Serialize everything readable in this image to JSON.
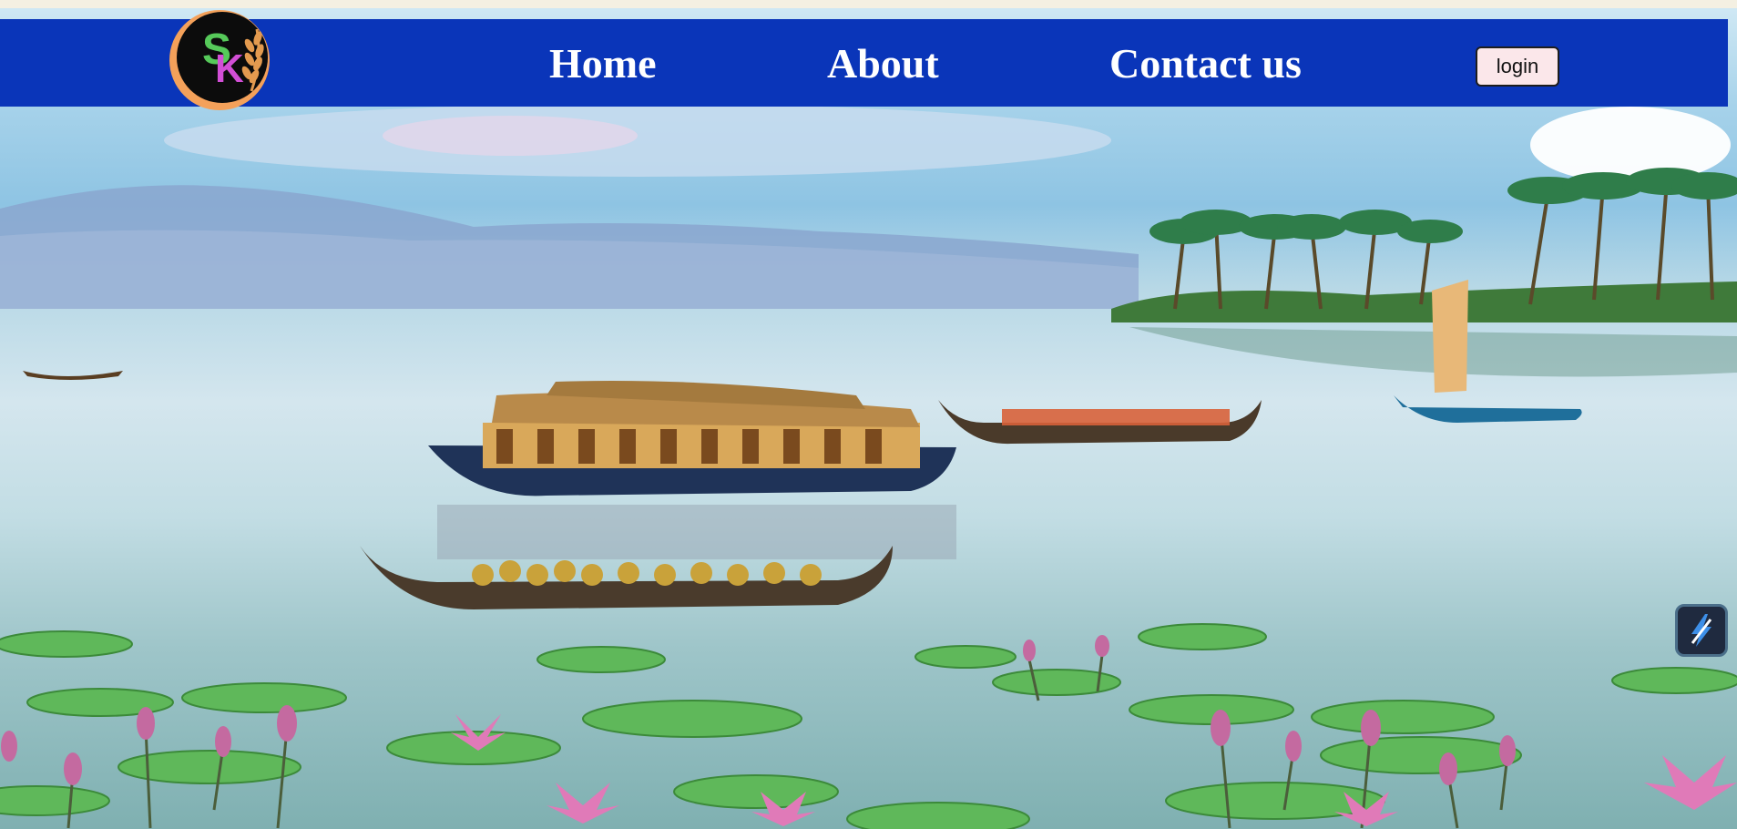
{
  "navbar": {
    "logo_text": "SK",
    "links": [
      {
        "label": "Home"
      },
      {
        "label": "About"
      },
      {
        "label": "Contact us"
      }
    ],
    "login_label": "login"
  },
  "colors": {
    "navbar_bg": "#0a35b9",
    "nav_text": "#ffffff",
    "login_bg": "#fbe7ea"
  },
  "icons": {
    "logo": "sk-wheat-logo",
    "floating_button": "lightning-bolt-icon"
  }
}
